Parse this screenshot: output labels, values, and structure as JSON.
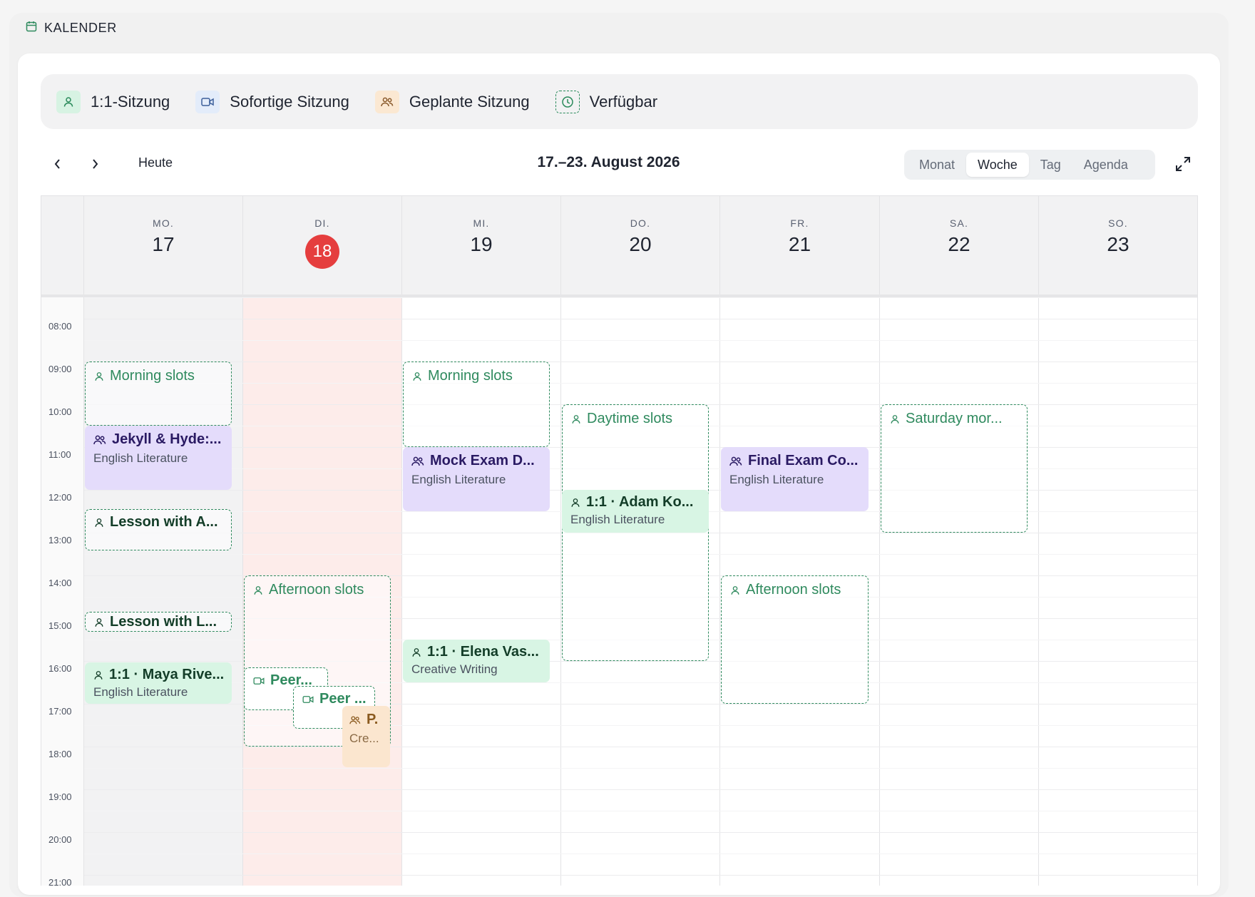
{
  "header": {
    "title": "KALENDER",
    "icon": "calendar-icon"
  },
  "legend": [
    {
      "label": "1:1-Sitzung",
      "icon": "person-icon"
    },
    {
      "label": "Sofortige Sitzung",
      "icon": "video-icon"
    },
    {
      "label": "Geplante Sitzung",
      "icon": "group-icon"
    },
    {
      "label": "Verfügbar",
      "icon": "clock-icon"
    }
  ],
  "toolbar": {
    "today_label": "Heute",
    "range_title": "17.–23. August 2026",
    "views": [
      "Monat",
      "Woche",
      "Tag",
      "Agenda"
    ],
    "active_view": "Woche"
  },
  "days": [
    {
      "name": "MO.",
      "num": "17"
    },
    {
      "name": "DI.",
      "num": "18",
      "today": true
    },
    {
      "name": "MI.",
      "num": "19"
    },
    {
      "name": "DO.",
      "num": "20"
    },
    {
      "name": "FR.",
      "num": "21"
    },
    {
      "name": "SA.",
      "num": "22"
    },
    {
      "name": "SO.",
      "num": "23"
    }
  ],
  "times": [
    "08:00",
    "09:00",
    "10:00",
    "11:00",
    "12:00",
    "13:00",
    "14:00",
    "15:00",
    "16:00",
    "17:00",
    "18:00",
    "19:00",
    "20:00",
    "21:00"
  ],
  "events": {
    "mon_morning": {
      "title": "Morning slots"
    },
    "mon_jekyll": {
      "title": "Jekyll & Hyde:...",
      "subtitle": "English Literature"
    },
    "mon_lesson_a": {
      "title": "Lesson with A..."
    },
    "mon_lesson_l": {
      "title": "Lesson with L..."
    },
    "mon_maya": {
      "title": "1:1 · Maya Rive...",
      "subtitle": "English Literature"
    },
    "tue_afternoon": {
      "title": "Afternoon slots"
    },
    "tue_peer1": {
      "title": "Peer..."
    },
    "tue_peer2": {
      "title": "Peer ..."
    },
    "tue_p": {
      "title": "P.",
      "subtitle": "Cre..."
    },
    "wed_morning": {
      "title": "Morning slots"
    },
    "wed_mock": {
      "title": "Mock Exam D...",
      "subtitle": "English Literature"
    },
    "wed_elena": {
      "title": "1:1 · Elena Vas...",
      "subtitle": "Creative Writing"
    },
    "thu_daytime": {
      "title": "Daytime slots"
    },
    "thu_adam": {
      "title": "1:1 · Adam Ko...",
      "subtitle": "English Literature"
    },
    "fri_final": {
      "title": "Final Exam Co...",
      "subtitle": "English Literature"
    },
    "fri_afternoon": {
      "title": "Afternoon slots"
    },
    "sat_morning": {
      "title": "Saturday mor..."
    }
  },
  "colors": {
    "accent_green": "#2f8a5e",
    "purple_event": "#e4dcfb",
    "green_event": "#d8f5e4",
    "orange_event": "#fbe6cf",
    "today_red": "#e53e3e"
  }
}
